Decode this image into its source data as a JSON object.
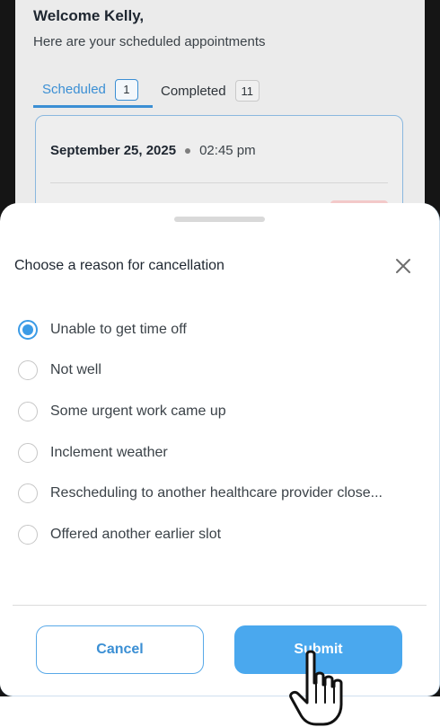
{
  "header": {
    "welcome": "Welcome Kelly,",
    "subtitle": "Here are your scheduled appointments"
  },
  "tabs": [
    {
      "label": "Scheduled",
      "count": "1",
      "active": true
    },
    {
      "label": "Completed",
      "count": "11",
      "active": false
    }
  ],
  "appointment": {
    "date": "September 25, 2025",
    "time": "02:45 pm"
  },
  "sheet": {
    "title": "Choose a reason for cancellation",
    "options": [
      {
        "label": "Unable to get time off",
        "selected": true
      },
      {
        "label": "Not well",
        "selected": false
      },
      {
        "label": "Some urgent work came up",
        "selected": false
      },
      {
        "label": "Inclement weather",
        "selected": false
      },
      {
        "label": "Rescheduling to another healthcare provider close...",
        "selected": false
      },
      {
        "label": "Offered another earlier slot",
        "selected": false
      }
    ],
    "cancel_label": "Cancel",
    "submit_label": "Submit"
  },
  "colors": {
    "accent": "#3b9be6",
    "submit_bg": "#4aa8ee",
    "overlay": "#ebebeb"
  },
  "icons": {
    "close": "close-icon",
    "cursor": "hand-pointer-icon"
  }
}
